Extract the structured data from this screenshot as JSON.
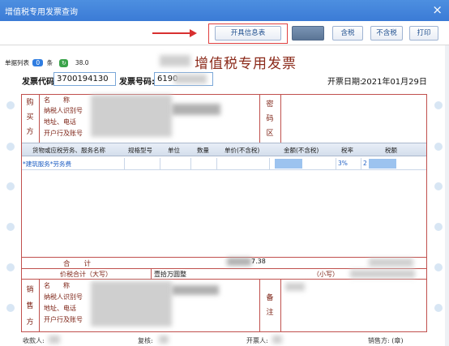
{
  "window": {
    "title": "增值税专用发票查询",
    "close": "×"
  },
  "toolbar": {
    "invoice_info_label": "开具信息表",
    "tax_incl_label": "含税",
    "tax_excl_label": "不含税",
    "print_label": "打印"
  },
  "listbar": {
    "label": "单据列表",
    "count": "0",
    "unit": "条",
    "value": "38.0"
  },
  "invoice": {
    "title": "增值税专用发票",
    "code_label": "发票代码:",
    "code_value": "3700194130",
    "number_label": "发票号码:",
    "number_value": "6190",
    "date_label": "开票日期:",
    "date_value": "2021年01月29日"
  },
  "buyer": {
    "side_label": [
      "购",
      "买",
      "方"
    ],
    "name": "名　　称",
    "taxid": "纳税人识别号",
    "address": "地址、电话",
    "bank": "开户行及账号",
    "cipher_label": [
      "密",
      "码",
      "区"
    ]
  },
  "columns": [
    "货物或应税劳务、服务名称",
    "规格型号",
    "单位",
    "数量",
    "单价(不含税)",
    "金额(不含税)",
    "税率",
    "税额"
  ],
  "items": [
    {
      "name": "*建筑服务*劳务费",
      "rate": "3%",
      "tax": "2"
    }
  ],
  "totals": {
    "sum_label": "合　　计",
    "sum_value": "7.38",
    "total_label": "价税合计（大写）",
    "total_value_cn": "壹拾万圆整",
    "small_label": "（小写）"
  },
  "seller": {
    "side_label": [
      "销",
      "售",
      "方"
    ],
    "name": "名　　称",
    "taxid": "纳税人识别号",
    "address": "地址、电话",
    "bank": "开户行及账号",
    "remark_label": [
      "备",
      "注"
    ]
  },
  "footer": {
    "receiver": "收款人:",
    "checker": "复核:",
    "issuer": "开票人:",
    "seller_seal": "销售方: (章)"
  },
  "colors": {
    "title_bar": "#3b7bd6",
    "frame": "#c0504d",
    "annotation": "#e04040"
  }
}
